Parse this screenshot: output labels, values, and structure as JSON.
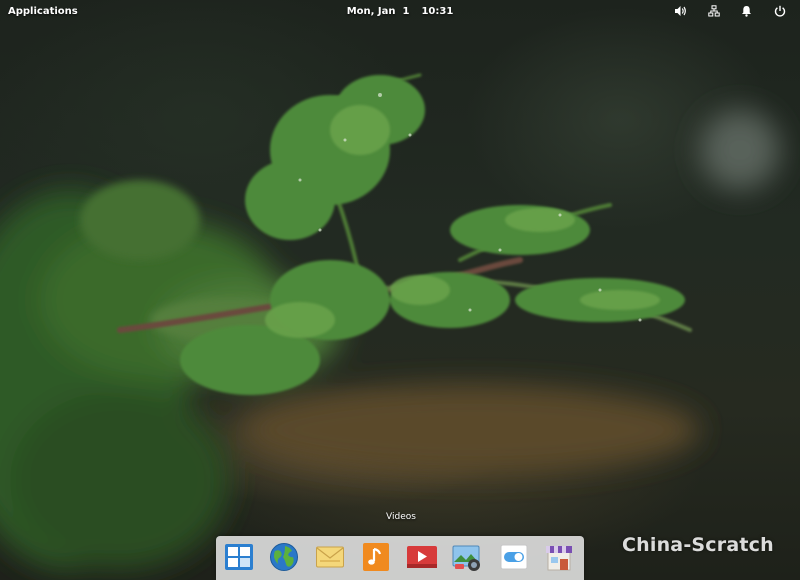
{
  "panel": {
    "applications_label": "Applications",
    "date": "Mon, Jan  1",
    "time": "10:31",
    "indicators": [
      {
        "name": "sound-icon"
      },
      {
        "name": "network-icon"
      },
      {
        "name": "notifications-icon"
      },
      {
        "name": "power-icon"
      }
    ]
  },
  "dock": {
    "tooltip": "Videos",
    "apps": [
      {
        "name": "multitasking-view",
        "icon": "multitasking-view-icon"
      },
      {
        "name": "web-browser",
        "icon": "globe-icon"
      },
      {
        "name": "mail",
        "icon": "mail-icon"
      },
      {
        "name": "music",
        "icon": "music-note-icon"
      },
      {
        "name": "videos",
        "icon": "video-play-icon"
      },
      {
        "name": "photos",
        "icon": "photos-camera-icon"
      },
      {
        "name": "system-settings",
        "icon": "toggle-switch-icon"
      },
      {
        "name": "appcenter",
        "icon": "shop-icon"
      }
    ]
  },
  "watermark": "China-Scratch",
  "colors": {
    "panel_text": "#ffffff",
    "dock_background": "#ebebeb",
    "foliage": "#3e6a2e"
  }
}
